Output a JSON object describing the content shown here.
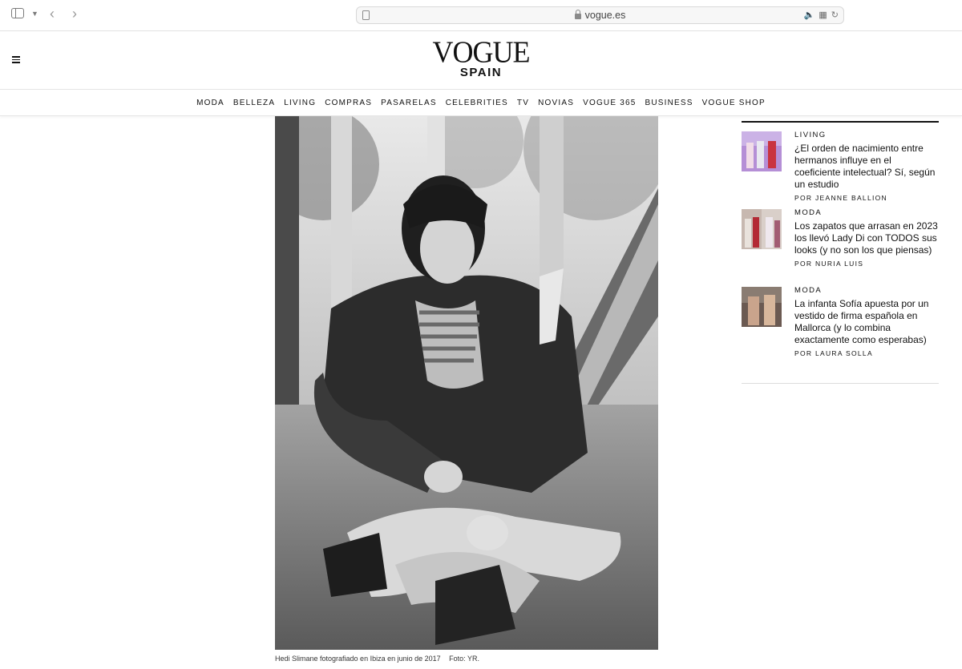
{
  "browser": {
    "url": "vogue.es"
  },
  "site": {
    "logo": "VOGUE",
    "edition": "SPAIN",
    "nav": [
      "MODA",
      "BELLEZA",
      "LIVING",
      "COMPRAS",
      "PASARELAS",
      "CELEBRITIES",
      "TV",
      "NOVIAS",
      "VOGUE 365",
      "BUSINESS",
      "VOGUE SHOP"
    ]
  },
  "hero": {
    "caption": "Hedi Slimane fotografiado en Ibiza en junio de 2017",
    "credit": "Foto: YR."
  },
  "sidebar": {
    "stories": [
      {
        "category": "LIVING",
        "title": "¿El orden de nacimiento entre hermanos influye en el coeficiente intelectual? Sí, según un estudio",
        "byline": "POR JEANNE BALLION"
      },
      {
        "category": "MODA",
        "title": "Los zapatos que arrasan en 2023 los llevó Lady Di con TODOS sus looks (y no son los que piensas)",
        "byline": "POR NURIA LUIS"
      },
      {
        "category": "MODA",
        "title": "La infanta Sofía apuesta por un vestido de firma española en Mallorca (y lo combina exactamente como esperabas)",
        "byline": "POR LAURA SOLLA"
      }
    ]
  }
}
